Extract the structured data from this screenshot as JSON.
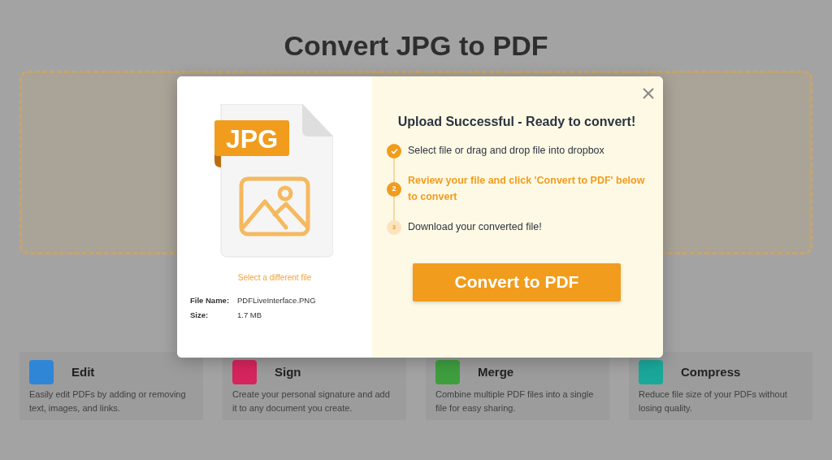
{
  "page": {
    "title": "Convert JPG to PDF",
    "tools": [
      {
        "name": "Edit",
        "description": "Easily edit PDFs by adding or removing text, images, and links.",
        "color": "#2f86d6"
      },
      {
        "name": "Sign",
        "description": "Create your personal signature and add it to any document you create.",
        "color": "#d6245e"
      },
      {
        "name": "Merge",
        "description": "Combine multiple PDF files into a single file for easy sharing.",
        "color": "#3e9e3e"
      },
      {
        "name": "Compress",
        "description": "Reduce file size of your PDFs without losing quality.",
        "color": "#1aa89a"
      }
    ]
  },
  "modal": {
    "file_badge": "JPG",
    "change_link": "Select a different file",
    "file_info": [
      {
        "label": "File Name:",
        "value": "PDFLiveInterface.PNG"
      },
      {
        "label": "Size:",
        "value": "1.7 MB"
      }
    ],
    "heading": "Upload Successful - Ready to convert!",
    "steps": [
      {
        "done": true,
        "selected": false,
        "text": "Select file or drag and drop file into dropbox"
      },
      {
        "done": false,
        "selected": true,
        "number": "2",
        "text": "Review your file and click 'Convert to PDF' below to convert"
      },
      {
        "done": false,
        "selected": false,
        "number": "3",
        "text": "Download your converted file!"
      }
    ],
    "convert_button": "Convert to PDF"
  }
}
